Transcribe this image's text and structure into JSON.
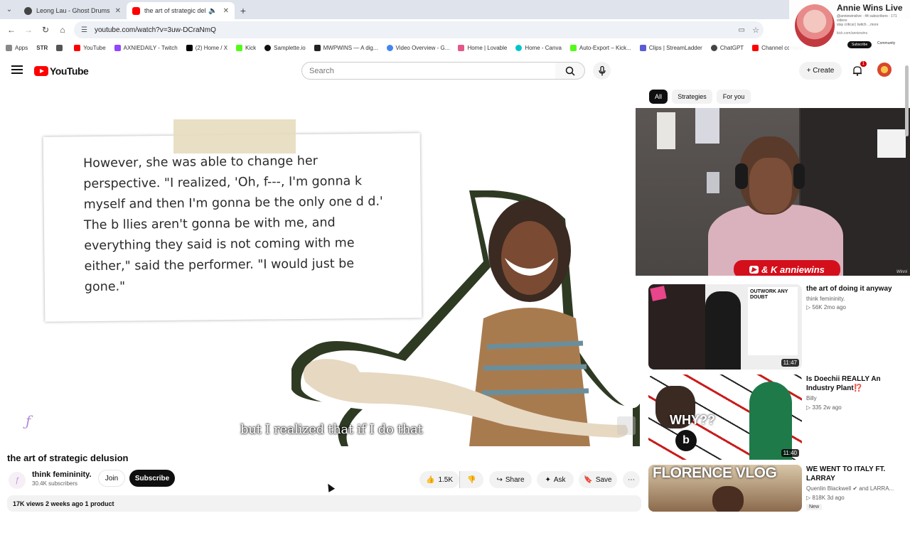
{
  "browser": {
    "tabs": [
      {
        "title": "Leong Lau - Ghost Drums",
        "active": false
      },
      {
        "title": "the art of strategic delusion",
        "active": true
      }
    ],
    "url": "youtube.com/watch?v=3uw-DCraNmQ",
    "bookmarks": [
      "Apps",
      "STR",
      "YouTube",
      "AXNIEDAILY - Twitch",
      "(2) Home / X",
      "Kick",
      "Samplette.io",
      "MWPWINS — A dig...",
      "Video Overview - G...",
      "Home | Lovable",
      "Home - Canva",
      "Auto-Export – Kick...",
      "Clips | StreamLadder",
      "ChatGPT",
      "Channel content"
    ]
  },
  "stream_overlay": {
    "title": "Annie Wins Live",
    "sub": "@anniewinslive · 44 subscribers · 171 videos",
    "desc": "stay critical | twitch ...more",
    "link": "kick.com/anniewins",
    "subscribe": "Subscribe",
    "community": "Community"
  },
  "youtube": {
    "logo": "YouTube",
    "search_placeholder": "Search",
    "create": "+ Create",
    "notif_count": "1"
  },
  "video": {
    "quote": "However, she was able to change her perspective. \"I realized, 'Oh, f---, I'm gonna k     myself and then I'm gonna be the only one d   d.' The b  llies aren't gonna be with me, and everything they said is not coming with me either,\" said the performer. \"I would just be gone.\"",
    "subtitle": "but I realized that if I do that",
    "title": "the art of strategic delusion",
    "channel": "think femininity.",
    "subscribers": "30.4K subscribers",
    "join": "Join",
    "subscribe": "Subscribe",
    "likes": "1.5K",
    "share": "Share",
    "ask": "Ask",
    "save": "Save",
    "meta": "17K views  2 weeks ago  1 product"
  },
  "chips": [
    "All",
    "Strategies",
    "For you"
  ],
  "webcam": {
    "tag": "& K anniewins",
    "caption": "Winni"
  },
  "recommendations": [
    {
      "title": "the art of doing it anyway",
      "channel": "think femininity.",
      "stats": "▷ 56K   2mo ago",
      "duration": "11:47",
      "thumb_text": "OUTWORK ANY DOUBT"
    },
    {
      "title": "Is Doechii REALLY An Industry Plant⁉️",
      "channel": "Billy",
      "stats": "▷ 335   2w ago",
      "duration": "11:40",
      "thumb_text": "WHY??"
    },
    {
      "title": "WE WENT TO ITALY FT. LARRAY",
      "channel": "Quenlin Blackwell ✔ and LARRA...",
      "stats": "▷ 818K   3d ago",
      "badge": "New",
      "thumb_text": "FLORENCE VLOG"
    }
  ],
  "colors": {
    "yt_red": "#ff0000",
    "chip_active": "#0f0f0f",
    "webcam_tag": "#d40f1c"
  }
}
